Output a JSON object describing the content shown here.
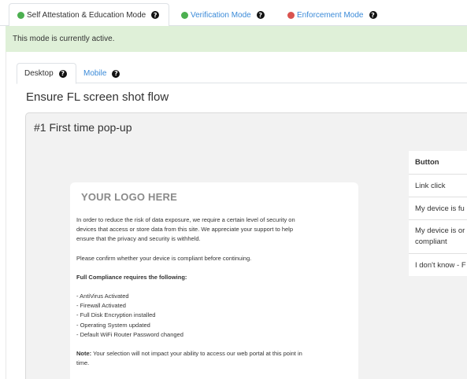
{
  "mode_tabs": [
    {
      "label": "Self Attestation & Education Mode",
      "dot_color": "#4caf50"
    },
    {
      "label": "Verification Mode",
      "dot_color": "#4caf50"
    },
    {
      "label": "Enforcement Mode",
      "dot_color": "#d9534f"
    }
  ],
  "banner": {
    "text": "This mode is currently active."
  },
  "device_tabs": [
    {
      "label": "Desktop"
    },
    {
      "label": "Mobile"
    }
  ],
  "help_icon_glyph": "?",
  "section_title": "Ensure FL screen shot flow",
  "card": {
    "title": "#1 First time pop-up",
    "popup": {
      "logo": "YOUR LOGO HERE",
      "intro_lines": [
        "In order to reduce the risk of data exposure, we require a certain level of security on",
        "devices that access or store data from this site. We appreciate your support to help",
        "ensure that the privacy and security is withheld."
      ],
      "confirm": "Please confirm whether your device is compliant before continuing.",
      "requirements_heading": "Full Compliance requires the following:",
      "requirements": [
        "- AntiVirus Activated",
        "- Firewall Activated",
        "- Full Disk Encryption installed",
        "- Operating System updated",
        "- Default WiFi Router Password changed"
      ],
      "note_label": "Note:",
      "note_lines": [
        " Your selection will not impact your ability to access our web portal at this point in",
        "time."
      ]
    },
    "button_table": {
      "header": "Button",
      "rows": [
        "Link click",
        "My device is fu",
        "My device is or",
        "compliant",
        "I don't know - F"
      ]
    }
  }
}
